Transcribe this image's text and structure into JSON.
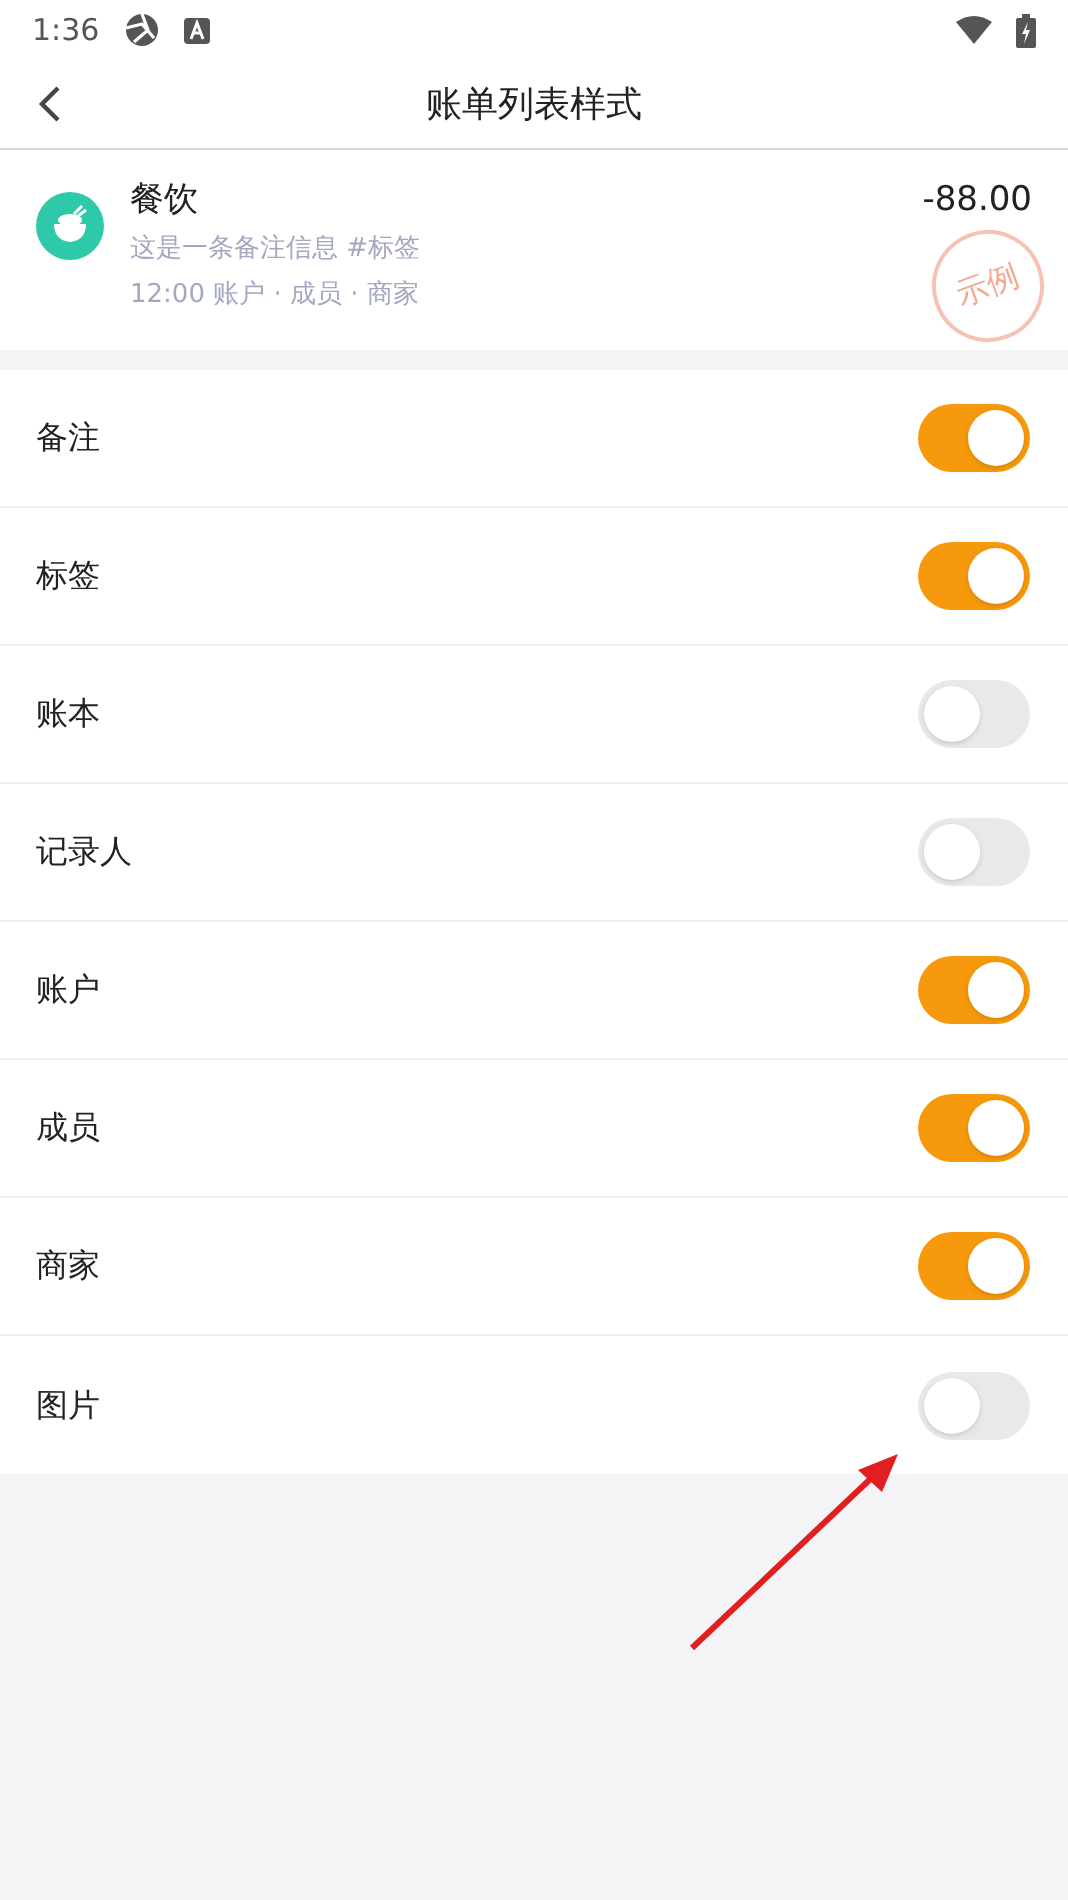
{
  "status_bar": {
    "time": "1:36"
  },
  "header": {
    "title": "账单列表样式"
  },
  "preview": {
    "category": "餐饮",
    "note": "这是一条备注信息 #标签",
    "meta": "12:00 账户 · 成员 · 商家",
    "amount": "-88.00",
    "stamp": "示例"
  },
  "settings": [
    {
      "label": "备注",
      "on": true
    },
    {
      "label": "标签",
      "on": true
    },
    {
      "label": "账本",
      "on": false
    },
    {
      "label": "记录人",
      "on": false
    },
    {
      "label": "账户",
      "on": true
    },
    {
      "label": "成员",
      "on": true
    },
    {
      "label": "商家",
      "on": true
    },
    {
      "label": "图片",
      "on": false
    }
  ],
  "annotation_arrow": true
}
